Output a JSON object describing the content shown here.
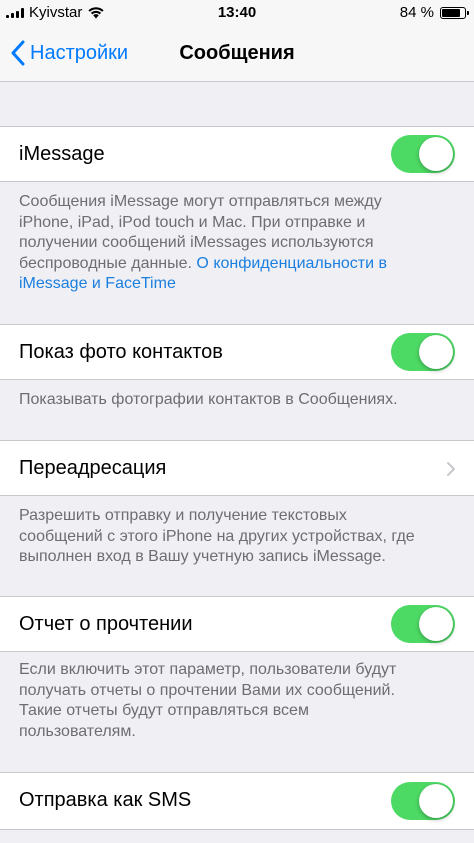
{
  "status_bar": {
    "carrier": "Kyivstar",
    "time": "13:40",
    "battery_text": "84 %",
    "battery_level": 0.84,
    "icons": [
      "signal-icon",
      "wifi-icon",
      "battery-icon"
    ]
  },
  "nav": {
    "back_label": "Настройки",
    "title": "Сообщения"
  },
  "imessage": {
    "label": "iMessage",
    "enabled": true,
    "footer_text": "Сообщения iMessage могут отправляться между iPhone, iPad, iPod touch и Mac. При отправке и получении сообщений iMessages используются беспроводные данные. ",
    "footer_link": "О конфиденциальности в iMessage и FaceTime"
  },
  "contact_photos": {
    "label": "Показ фото контактов",
    "enabled": true,
    "footer_text": "Показывать фотографии контактов в Сообщениях."
  },
  "forwarding": {
    "label": "Переадресация",
    "footer_text": "Разрешить отправку и получение текстовых сообщений с этого iPhone на других устройствах, где выполнен вход в Вашу учетную запись iMessage."
  },
  "read_receipts": {
    "label": "Отчет о прочтении",
    "enabled": true,
    "footer_text": "Если включить этот параметр, пользователи будут получать отчеты о прочтении Вами их сообщений. Такие отчеты будут отправляться всем пользователям."
  },
  "send_as_sms": {
    "label": "Отправка как SMS",
    "enabled": true
  },
  "colors": {
    "accent": "#007aff",
    "toggle_on": "#4cd964",
    "background": "#efeff4"
  }
}
